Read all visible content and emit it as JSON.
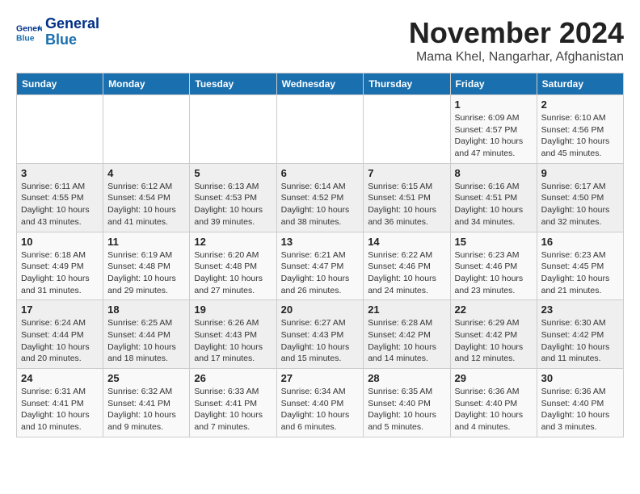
{
  "header": {
    "logo_line1": "General",
    "logo_line2": "Blue",
    "month_title": "November 2024",
    "location": "Mama Khel, Nangarhar, Afghanistan"
  },
  "days_of_week": [
    "Sunday",
    "Monday",
    "Tuesday",
    "Wednesday",
    "Thursday",
    "Friday",
    "Saturday"
  ],
  "weeks": [
    [
      {
        "day": "",
        "info": ""
      },
      {
        "day": "",
        "info": ""
      },
      {
        "day": "",
        "info": ""
      },
      {
        "day": "",
        "info": ""
      },
      {
        "day": "",
        "info": ""
      },
      {
        "day": "1",
        "info": "Sunrise: 6:09 AM\nSunset: 4:57 PM\nDaylight: 10 hours\nand 47 minutes."
      },
      {
        "day": "2",
        "info": "Sunrise: 6:10 AM\nSunset: 4:56 PM\nDaylight: 10 hours\nand 45 minutes."
      }
    ],
    [
      {
        "day": "3",
        "info": "Sunrise: 6:11 AM\nSunset: 4:55 PM\nDaylight: 10 hours\nand 43 minutes."
      },
      {
        "day": "4",
        "info": "Sunrise: 6:12 AM\nSunset: 4:54 PM\nDaylight: 10 hours\nand 41 minutes."
      },
      {
        "day": "5",
        "info": "Sunrise: 6:13 AM\nSunset: 4:53 PM\nDaylight: 10 hours\nand 39 minutes."
      },
      {
        "day": "6",
        "info": "Sunrise: 6:14 AM\nSunset: 4:52 PM\nDaylight: 10 hours\nand 38 minutes."
      },
      {
        "day": "7",
        "info": "Sunrise: 6:15 AM\nSunset: 4:51 PM\nDaylight: 10 hours\nand 36 minutes."
      },
      {
        "day": "8",
        "info": "Sunrise: 6:16 AM\nSunset: 4:51 PM\nDaylight: 10 hours\nand 34 minutes."
      },
      {
        "day": "9",
        "info": "Sunrise: 6:17 AM\nSunset: 4:50 PM\nDaylight: 10 hours\nand 32 minutes."
      }
    ],
    [
      {
        "day": "10",
        "info": "Sunrise: 6:18 AM\nSunset: 4:49 PM\nDaylight: 10 hours\nand 31 minutes."
      },
      {
        "day": "11",
        "info": "Sunrise: 6:19 AM\nSunset: 4:48 PM\nDaylight: 10 hours\nand 29 minutes."
      },
      {
        "day": "12",
        "info": "Sunrise: 6:20 AM\nSunset: 4:48 PM\nDaylight: 10 hours\nand 27 minutes."
      },
      {
        "day": "13",
        "info": "Sunrise: 6:21 AM\nSunset: 4:47 PM\nDaylight: 10 hours\nand 26 minutes."
      },
      {
        "day": "14",
        "info": "Sunrise: 6:22 AM\nSunset: 4:46 PM\nDaylight: 10 hours\nand 24 minutes."
      },
      {
        "day": "15",
        "info": "Sunrise: 6:23 AM\nSunset: 4:46 PM\nDaylight: 10 hours\nand 23 minutes."
      },
      {
        "day": "16",
        "info": "Sunrise: 6:23 AM\nSunset: 4:45 PM\nDaylight: 10 hours\nand 21 minutes."
      }
    ],
    [
      {
        "day": "17",
        "info": "Sunrise: 6:24 AM\nSunset: 4:44 PM\nDaylight: 10 hours\nand 20 minutes."
      },
      {
        "day": "18",
        "info": "Sunrise: 6:25 AM\nSunset: 4:44 PM\nDaylight: 10 hours\nand 18 minutes."
      },
      {
        "day": "19",
        "info": "Sunrise: 6:26 AM\nSunset: 4:43 PM\nDaylight: 10 hours\nand 17 minutes."
      },
      {
        "day": "20",
        "info": "Sunrise: 6:27 AM\nSunset: 4:43 PM\nDaylight: 10 hours\nand 15 minutes."
      },
      {
        "day": "21",
        "info": "Sunrise: 6:28 AM\nSunset: 4:42 PM\nDaylight: 10 hours\nand 14 minutes."
      },
      {
        "day": "22",
        "info": "Sunrise: 6:29 AM\nSunset: 4:42 PM\nDaylight: 10 hours\nand 12 minutes."
      },
      {
        "day": "23",
        "info": "Sunrise: 6:30 AM\nSunset: 4:42 PM\nDaylight: 10 hours\nand 11 minutes."
      }
    ],
    [
      {
        "day": "24",
        "info": "Sunrise: 6:31 AM\nSunset: 4:41 PM\nDaylight: 10 hours\nand 10 minutes."
      },
      {
        "day": "25",
        "info": "Sunrise: 6:32 AM\nSunset: 4:41 PM\nDaylight: 10 hours\nand 9 minutes."
      },
      {
        "day": "26",
        "info": "Sunrise: 6:33 AM\nSunset: 4:41 PM\nDaylight: 10 hours\nand 7 minutes."
      },
      {
        "day": "27",
        "info": "Sunrise: 6:34 AM\nSunset: 4:40 PM\nDaylight: 10 hours\nand 6 minutes."
      },
      {
        "day": "28",
        "info": "Sunrise: 6:35 AM\nSunset: 4:40 PM\nDaylight: 10 hours\nand 5 minutes."
      },
      {
        "day": "29",
        "info": "Sunrise: 6:36 AM\nSunset: 4:40 PM\nDaylight: 10 hours\nand 4 minutes."
      },
      {
        "day": "30",
        "info": "Sunrise: 6:36 AM\nSunset: 4:40 PM\nDaylight: 10 hours\nand 3 minutes."
      }
    ]
  ]
}
